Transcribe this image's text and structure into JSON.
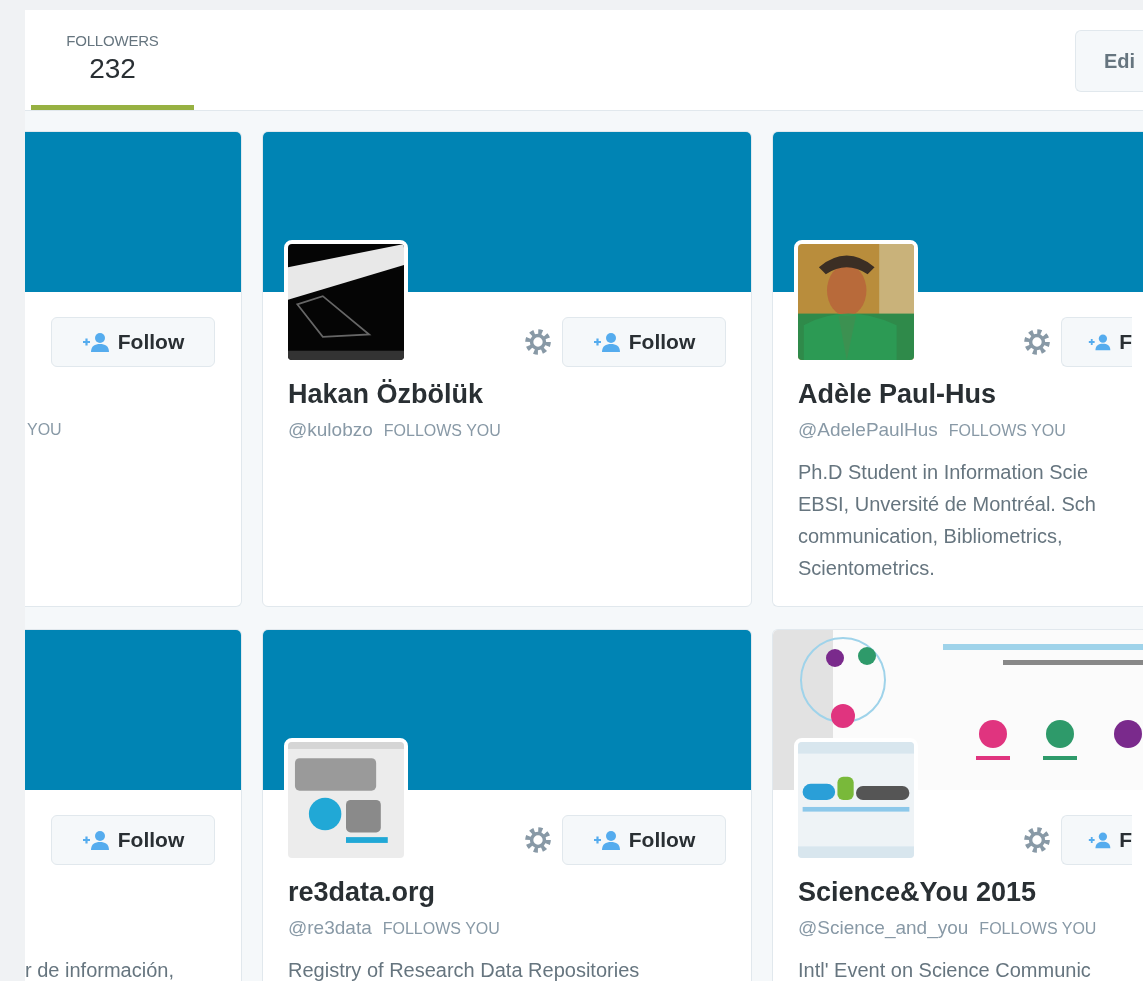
{
  "header": {
    "tab": {
      "label": "FOLLOWERS",
      "count": "232",
      "selected": true
    },
    "edit_button": "Edi"
  },
  "cards": [
    {
      "kind": "left_edge",
      "banner": {
        "kind": "solid"
      },
      "follow_label": "Follow",
      "follows_label": "YOU"
    },
    {
      "kind": "full",
      "banner": {
        "kind": "solid"
      },
      "follow_label": "Follow",
      "name": "Hakan Özbölük",
      "handle": "@kulobzo",
      "follows_label": "FOLLOWS YOU"
    },
    {
      "kind": "right_edge",
      "banner": {
        "kind": "solid"
      },
      "follow_label": "F",
      "name": "Adèle Paul-Hus",
      "handle": "@AdelePaulHus",
      "follows_label": "FOLLOWS YOU",
      "bio_lines": [
        "Ph.D Student in Information Scie",
        "EBSI, Unversité de Montréal. Sch",
        "communication, Bibliometrics,",
        "Scientometrics."
      ]
    },
    {
      "kind": "left_edge",
      "banner": {
        "kind": "solid"
      },
      "follow_label": "Follow",
      "bio_lines": [
        "r de información,"
      ]
    },
    {
      "kind": "full",
      "banner": {
        "kind": "solid"
      },
      "follow_label": "Follow",
      "name": "re3data.org",
      "handle": "@re3data",
      "follows_label": "FOLLOWS YOU",
      "bio_lines": [
        "Registry of Research Data Repositories"
      ]
    },
    {
      "kind": "right_edge",
      "follow_label": "F",
      "name": "Science&You 2015",
      "handle": "@Science_and_you",
      "follows_label": "FOLLOWS YOU",
      "bio_lines": [
        "Intl' Event on Science Communic"
      ]
    }
  ]
}
